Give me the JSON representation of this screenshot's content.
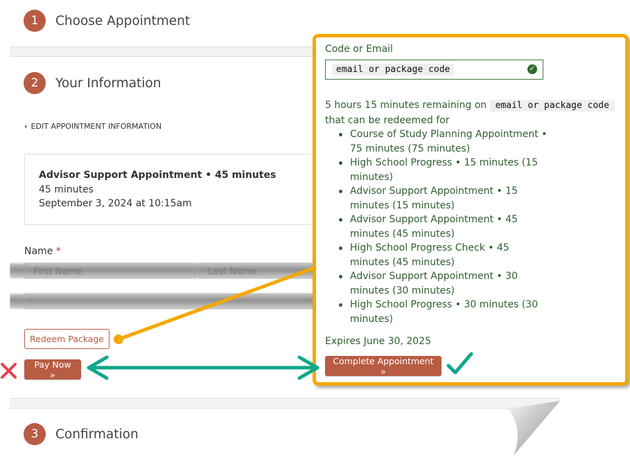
{
  "steps": [
    {
      "number": "1",
      "title": "Choose Appointment"
    },
    {
      "number": "2",
      "title": "Your Information"
    },
    {
      "number": "3",
      "title": "Confirmation"
    }
  ],
  "edit_link": "EDIT APPOINTMENT INFORMATION",
  "appointment": {
    "title": "Advisor Support Appointment • 45 minutes",
    "duration": "45 minutes",
    "datetime": "September 3, 2024 at 10:15am"
  },
  "name_field": {
    "label": "Name",
    "required_marker": "*",
    "first_placeholder": "First Name",
    "last_placeholder": "Last Name"
  },
  "buttons": {
    "redeem": "Redeem Package",
    "pay_now": "Pay Now »",
    "complete": "Complete Appointment »"
  },
  "redeem_panel": {
    "label": "Code or Email",
    "input_value": "email or package code",
    "remaining_prefix": "5 hours 15 minutes remaining on",
    "remaining_code": "email or package code",
    "remaining_suffix": "that can be redeemed for",
    "packages": [
      "Course of Study Planning Appointment • 75 minutes (75 minutes)",
      "High School Progress • 15 minutes (15 minutes)",
      "Advisor Support Appointment • 15 minutes (15 minutes)",
      "Advisor Support Appointment • 45 minutes (45 minutes)",
      "High School Progress Check • 45 minutes (45 minutes)",
      "Advisor Support Appointment • 30 minutes (30 minutes)",
      "High School Progress • 30 minutes (30 minutes)"
    ],
    "expires": "Expires June 30, 2025"
  },
  "annotations": {
    "wrong_mark": "✕",
    "right_mark": "✓"
  },
  "colors": {
    "brand": "#b85c44",
    "callout_border": "#f5a800",
    "panel_text": "#2f5e2f",
    "arrow": "#0fa88a",
    "wrong": "#e8404a"
  }
}
